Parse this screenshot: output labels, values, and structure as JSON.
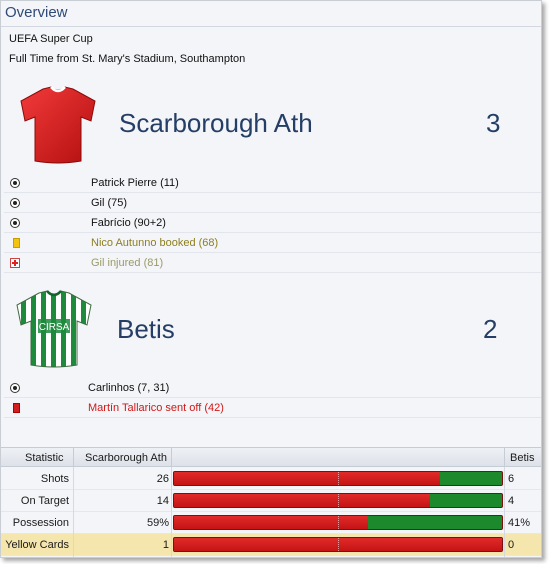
{
  "panel": {
    "title": "Overview",
    "competition": "UEFA Super Cup",
    "venue_text": "Full Time from St. Mary's Stadium, Southampton"
  },
  "home": {
    "name": "Scarborough Ath",
    "score": "3",
    "shirt_colors": {
      "main": "#e01f1f",
      "dark": "#a50e0e"
    },
    "events": [
      {
        "icon": "ball-icon",
        "text": "Patrick Pierre (11)",
        "style": "normal"
      },
      {
        "icon": "ball-icon",
        "text": "Gil (75)",
        "style": "normal"
      },
      {
        "icon": "ball-icon",
        "text": "Fabrício (90+2)",
        "style": "normal"
      },
      {
        "icon": "yellow-card-icon",
        "text": "Nico Autunno booked (68)",
        "style": "booked"
      },
      {
        "icon": "injury-icon",
        "text": "Gil injured (81)",
        "style": "injured"
      }
    ]
  },
  "away": {
    "name": "Betis",
    "score": "2",
    "shirt_text": "CIRSA",
    "shirt_colors": {
      "stripe_green": "#1d8a3c",
      "stripe_white": "#ffffff"
    },
    "events": [
      {
        "icon": "ball-icon",
        "text": "Carlinhos (7, 31)",
        "style": "normal"
      },
      {
        "icon": "red-card-icon",
        "text": "Martín Tallarico sent off (42)",
        "style": "sentoff"
      }
    ]
  },
  "stats": {
    "header": {
      "statistic": "Statistic",
      "home": "Scarborough Ath",
      "away": "Betis"
    },
    "rows": [
      {
        "label": "Shots",
        "home": "26",
        "away": "6",
        "home_share": 0.81,
        "highlight": false
      },
      {
        "label": "On Target",
        "home": "14",
        "away": "4",
        "home_share": 0.78,
        "highlight": false
      },
      {
        "label": "Possession",
        "home": "59%",
        "away": "41%",
        "home_share": 0.59,
        "highlight": false
      },
      {
        "label": "Yellow Cards",
        "home": "1",
        "away": "0",
        "home_share": 1.0,
        "highlight": true
      }
    ],
    "colors": {
      "home": "#d21c1c",
      "away": "#1c8a2c"
    }
  }
}
